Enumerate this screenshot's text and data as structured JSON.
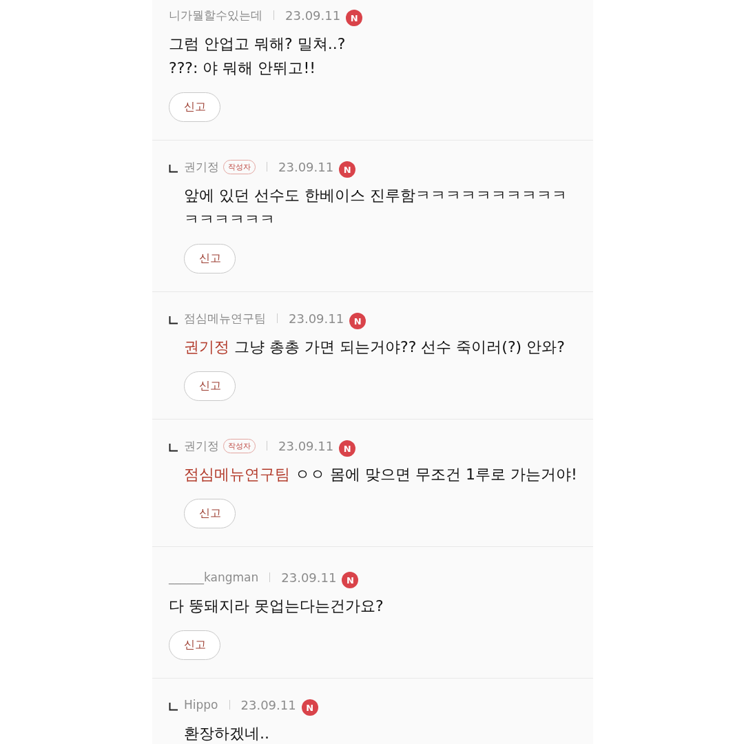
{
  "comments": [
    {
      "kind": "comment",
      "author": "니가뭘할수있는데",
      "date": "23.09.11",
      "new_badge": "N",
      "text": "그럼 안업고 뭐해? 밀쳐..?\n???: 야 뭐해 안뛰고!!",
      "report_button": "신고"
    },
    {
      "kind": "reply",
      "author": "권기정",
      "author_badge": "작성자",
      "date": "23.09.11",
      "new_badge": "N",
      "text": "앞에 있던 선수도 한베이스 진루함ㅋㅋㅋㅋㅋㅋㅋㅋㅋㅋㅋㅋㅋㅋㅋㅋ",
      "report_button": "신고"
    },
    {
      "kind": "reply",
      "author": "점심메뉴연구팀",
      "date": "23.09.11",
      "new_badge": "N",
      "mention": "권기정",
      "text": "그냥 총총 가면 되는거야?? 선수 죽이러(?) 안와?",
      "report_button": "신고"
    },
    {
      "kind": "reply",
      "author": "권기정",
      "author_badge": "작성자",
      "date": "23.09.11",
      "new_badge": "N",
      "mention": "점심메뉴연구팀",
      "text": "ㅇㅇ 몸에 맞으면 무조건 1루로 가는거야!",
      "report_button": "신고"
    },
    {
      "kind": "comment",
      "author": "______kangman",
      "date": "23.09.11",
      "new_badge": "N",
      "text": "다 뚱돼지라 못업는다는건가요?",
      "report_button": "신고"
    },
    {
      "kind": "reply",
      "author": "Hippo",
      "date": "23.09.11",
      "new_badge": "N",
      "text": "환장하겠네.."
    }
  ]
}
